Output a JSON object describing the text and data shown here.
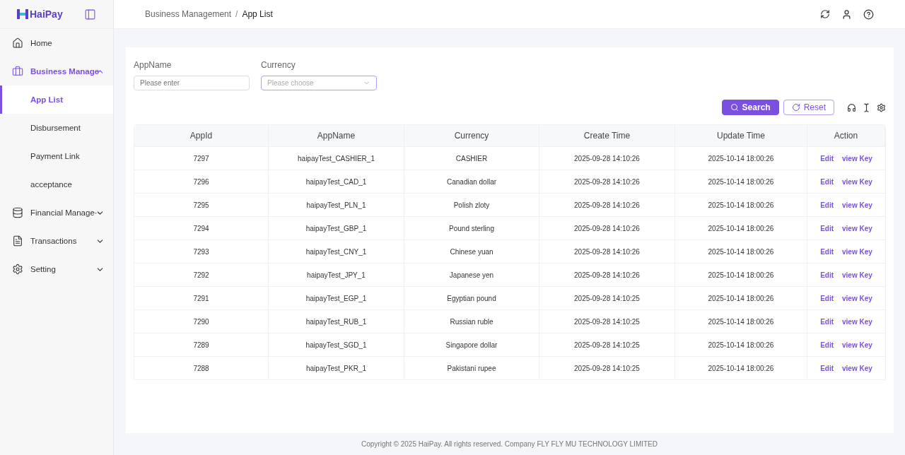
{
  "logo": {
    "text": "HaiPay"
  },
  "sidebar": {
    "items": [
      {
        "label": "Home",
        "selected": false
      },
      {
        "label": "Business Manage",
        "selected": true,
        "expanded": true,
        "children": [
          {
            "label": "App List",
            "selected": true
          },
          {
            "label": "Disbursement",
            "selected": false
          },
          {
            "label": "Payment Link",
            "selected": false
          },
          {
            "label": "acceptance",
            "selected": false
          }
        ]
      },
      {
        "label": "Financial Manage··",
        "selected": false,
        "expanded": false
      },
      {
        "label": "Transactions",
        "selected": false,
        "expanded": false
      },
      {
        "label": "Setting",
        "selected": false,
        "expanded": false
      }
    ]
  },
  "breadcrumb": [
    "Business Management",
    "App List"
  ],
  "breadcrumb_separator": "/",
  "filters": [
    {
      "label": "AppName",
      "kind": "input",
      "placeholder": "Please enter"
    },
    {
      "label": "Currency",
      "kind": "select",
      "placeholder": "Please choose"
    }
  ],
  "buttons": {
    "search": "Search",
    "reset": "Reset"
  },
  "table": {
    "columns": [
      "AppId",
      "AppName",
      "Currency",
      "Create Time",
      "Update Time",
      "Action"
    ],
    "rows": [
      {
        "cells": [
          "7297",
          "haipayTest_CASHIER_1",
          "CASHIER",
          "2025-09-28 14:10:26",
          "2025-10-14 18:00:26"
        ],
        "actions": [
          "Edit",
          "view Key"
        ]
      },
      {
        "cells": [
          "7296",
          "haipayTest_CAD_1",
          "Canadian dollar",
          "2025-09-28 14:10:26",
          "2025-10-14 18:00:26"
        ],
        "actions": [
          "Edit",
          "view Key"
        ]
      },
      {
        "cells": [
          "7295",
          "haipayTest_PLN_1",
          "Polish zloty",
          "2025-09-28 14:10:26",
          "2025-10-14 18:00:26"
        ],
        "actions": [
          "Edit",
          "view Key"
        ]
      },
      {
        "cells": [
          "7294",
          "haipayTest_GBP_1",
          "Pound sterling",
          "2025-09-28 14:10:26",
          "2025-10-14 18:00:26"
        ],
        "actions": [
          "Edit",
          "view Key"
        ]
      },
      {
        "cells": [
          "7293",
          "haipayTest_CNY_1",
          "Chinese yuan",
          "2025-09-28 14:10:26",
          "2025-10-14 18:00:26"
        ],
        "actions": [
          "Edit",
          "view Key"
        ]
      },
      {
        "cells": [
          "7292",
          "haipayTest_JPY_1",
          "Japanese yen",
          "2025-09-28 14:10:26",
          "2025-10-14 18:00:26"
        ],
        "actions": [
          "Edit",
          "view Key"
        ]
      },
      {
        "cells": [
          "7291",
          "haipayTest_EGP_1",
          "Egyptian pound",
          "2025-09-28 14:10:25",
          "2025-10-14 18:00:26"
        ],
        "actions": [
          "Edit",
          "view Key"
        ]
      },
      {
        "cells": [
          "7290",
          "haipayTest_RUB_1",
          "Russian ruble",
          "2025-09-28 14:10:25",
          "2025-10-14 18:00:26"
        ],
        "actions": [
          "Edit",
          "view Key"
        ]
      },
      {
        "cells": [
          "7289",
          "haipayTest_SGD_1",
          "Singapore dollar",
          "2025-09-28 14:10:25",
          "2025-10-14 18:00:26"
        ],
        "actions": [
          "Edit",
          "view Key"
        ]
      },
      {
        "cells": [
          "7288",
          "haipayTest_PKR_1",
          "Pakistani rupee",
          "2025-09-28 14:10:25",
          "2025-10-14 18:00:26"
        ],
        "actions": [
          "Edit",
          "view Key"
        ]
      }
    ]
  },
  "footer": "Copyright © 2025 HaiPay. All rights reserved. Company FLY FLY MU TECHNOLOGY LIMITED"
}
